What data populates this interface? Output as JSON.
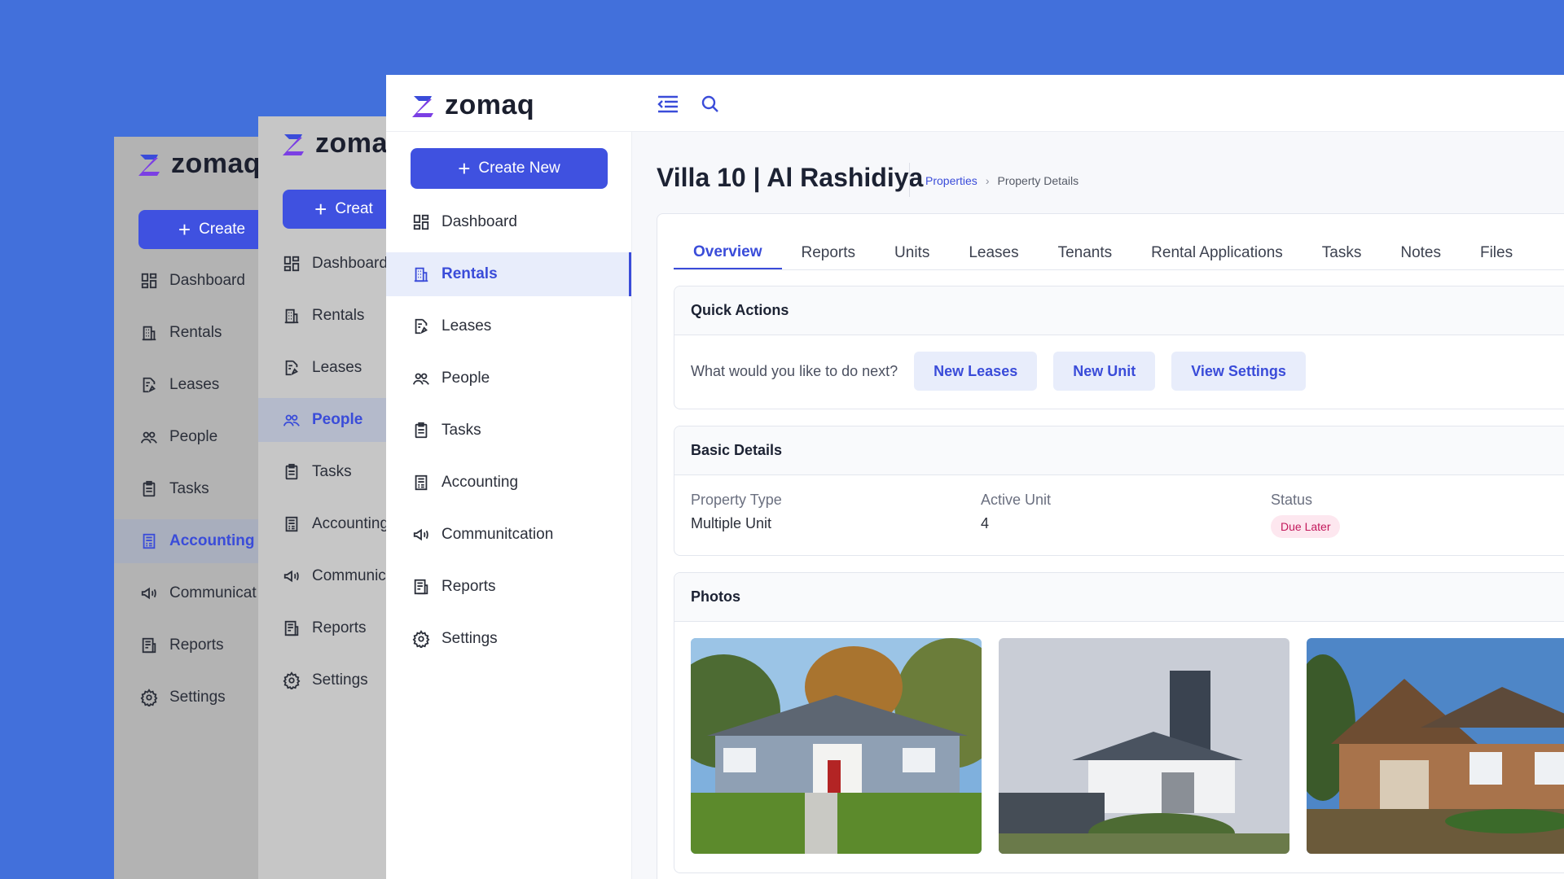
{
  "brand": {
    "name": "zomaq",
    "accent": "#3A4CD9",
    "button_color": "#3F51E0",
    "background": "#4270DB"
  },
  "back_pane_1": {
    "logo": "zomaq",
    "create_label": "Create",
    "nav": [
      {
        "label": "Dashboard",
        "icon": "dashboard-icon"
      },
      {
        "label": "Rentals",
        "icon": "building-icon"
      },
      {
        "label": "Leases",
        "icon": "lease-doc-icon"
      },
      {
        "label": "People",
        "icon": "people-icon"
      },
      {
        "label": "Tasks",
        "icon": "clipboard-icon"
      },
      {
        "label": "Accounting",
        "icon": "ledger-icon"
      },
      {
        "label": "Communicat",
        "icon": "megaphone-icon"
      },
      {
        "label": "Reports",
        "icon": "report-icon"
      },
      {
        "label": "Settings",
        "icon": "gear-icon"
      }
    ],
    "active": "Accounting"
  },
  "back_pane_2": {
    "logo": "zoma",
    "create_label": "Creat",
    "nav": [
      {
        "label": "Dashboard",
        "icon": "dashboard-icon"
      },
      {
        "label": "Rentals",
        "icon": "building-icon"
      },
      {
        "label": "Leases",
        "icon": "lease-doc-icon"
      },
      {
        "label": "People",
        "icon": "people-icon"
      },
      {
        "label": "Tasks",
        "icon": "clipboard-icon"
      },
      {
        "label": "Accounting",
        "icon": "ledger-icon"
      },
      {
        "label": "Communic",
        "icon": "megaphone-icon"
      },
      {
        "label": "Reports",
        "icon": "report-icon"
      },
      {
        "label": "Settings",
        "icon": "gear-icon"
      }
    ],
    "active": "People"
  },
  "main": {
    "logo": "zomaq",
    "topbar": {
      "menu_icon": "menu-collapse-icon",
      "search_icon": "search-icon"
    },
    "create_label": "Create New",
    "nav": [
      {
        "label": "Dashboard",
        "icon": "dashboard-icon"
      },
      {
        "label": "Rentals",
        "icon": "building-icon"
      },
      {
        "label": "Leases",
        "icon": "lease-doc-icon"
      },
      {
        "label": "People",
        "icon": "people-icon"
      },
      {
        "label": "Tasks",
        "icon": "clipboard-icon"
      },
      {
        "label": "Accounting",
        "icon": "ledger-icon"
      },
      {
        "label": "Communitcation",
        "icon": "megaphone-icon"
      },
      {
        "label": "Reports",
        "icon": "report-icon"
      },
      {
        "label": "Settings",
        "icon": "gear-icon"
      }
    ],
    "active": "Rentals",
    "page_title": "Villa 10 | Al Rashidiya",
    "breadcrumb": {
      "parent": "Properties",
      "current": "Property Details"
    },
    "tabs": [
      "Overview",
      "Reports",
      "Units",
      "Leases",
      "Tenants",
      "Rental Applications",
      "Tasks",
      "Notes",
      "Files"
    ],
    "active_tab": "Overview",
    "quick_actions": {
      "title": "Quick Actions",
      "prompt": "What would you like to do next?",
      "buttons": [
        "New Leases",
        "New Unit",
        "View Settings"
      ]
    },
    "basic_details": {
      "title": "Basic Details",
      "fields": [
        {
          "label": "Property Type",
          "value": "Multiple Unit"
        },
        {
          "label": "Active Unit",
          "value": "4"
        },
        {
          "label": "Status",
          "value": "Due Later"
        }
      ]
    },
    "photos": {
      "title": "Photos"
    }
  }
}
